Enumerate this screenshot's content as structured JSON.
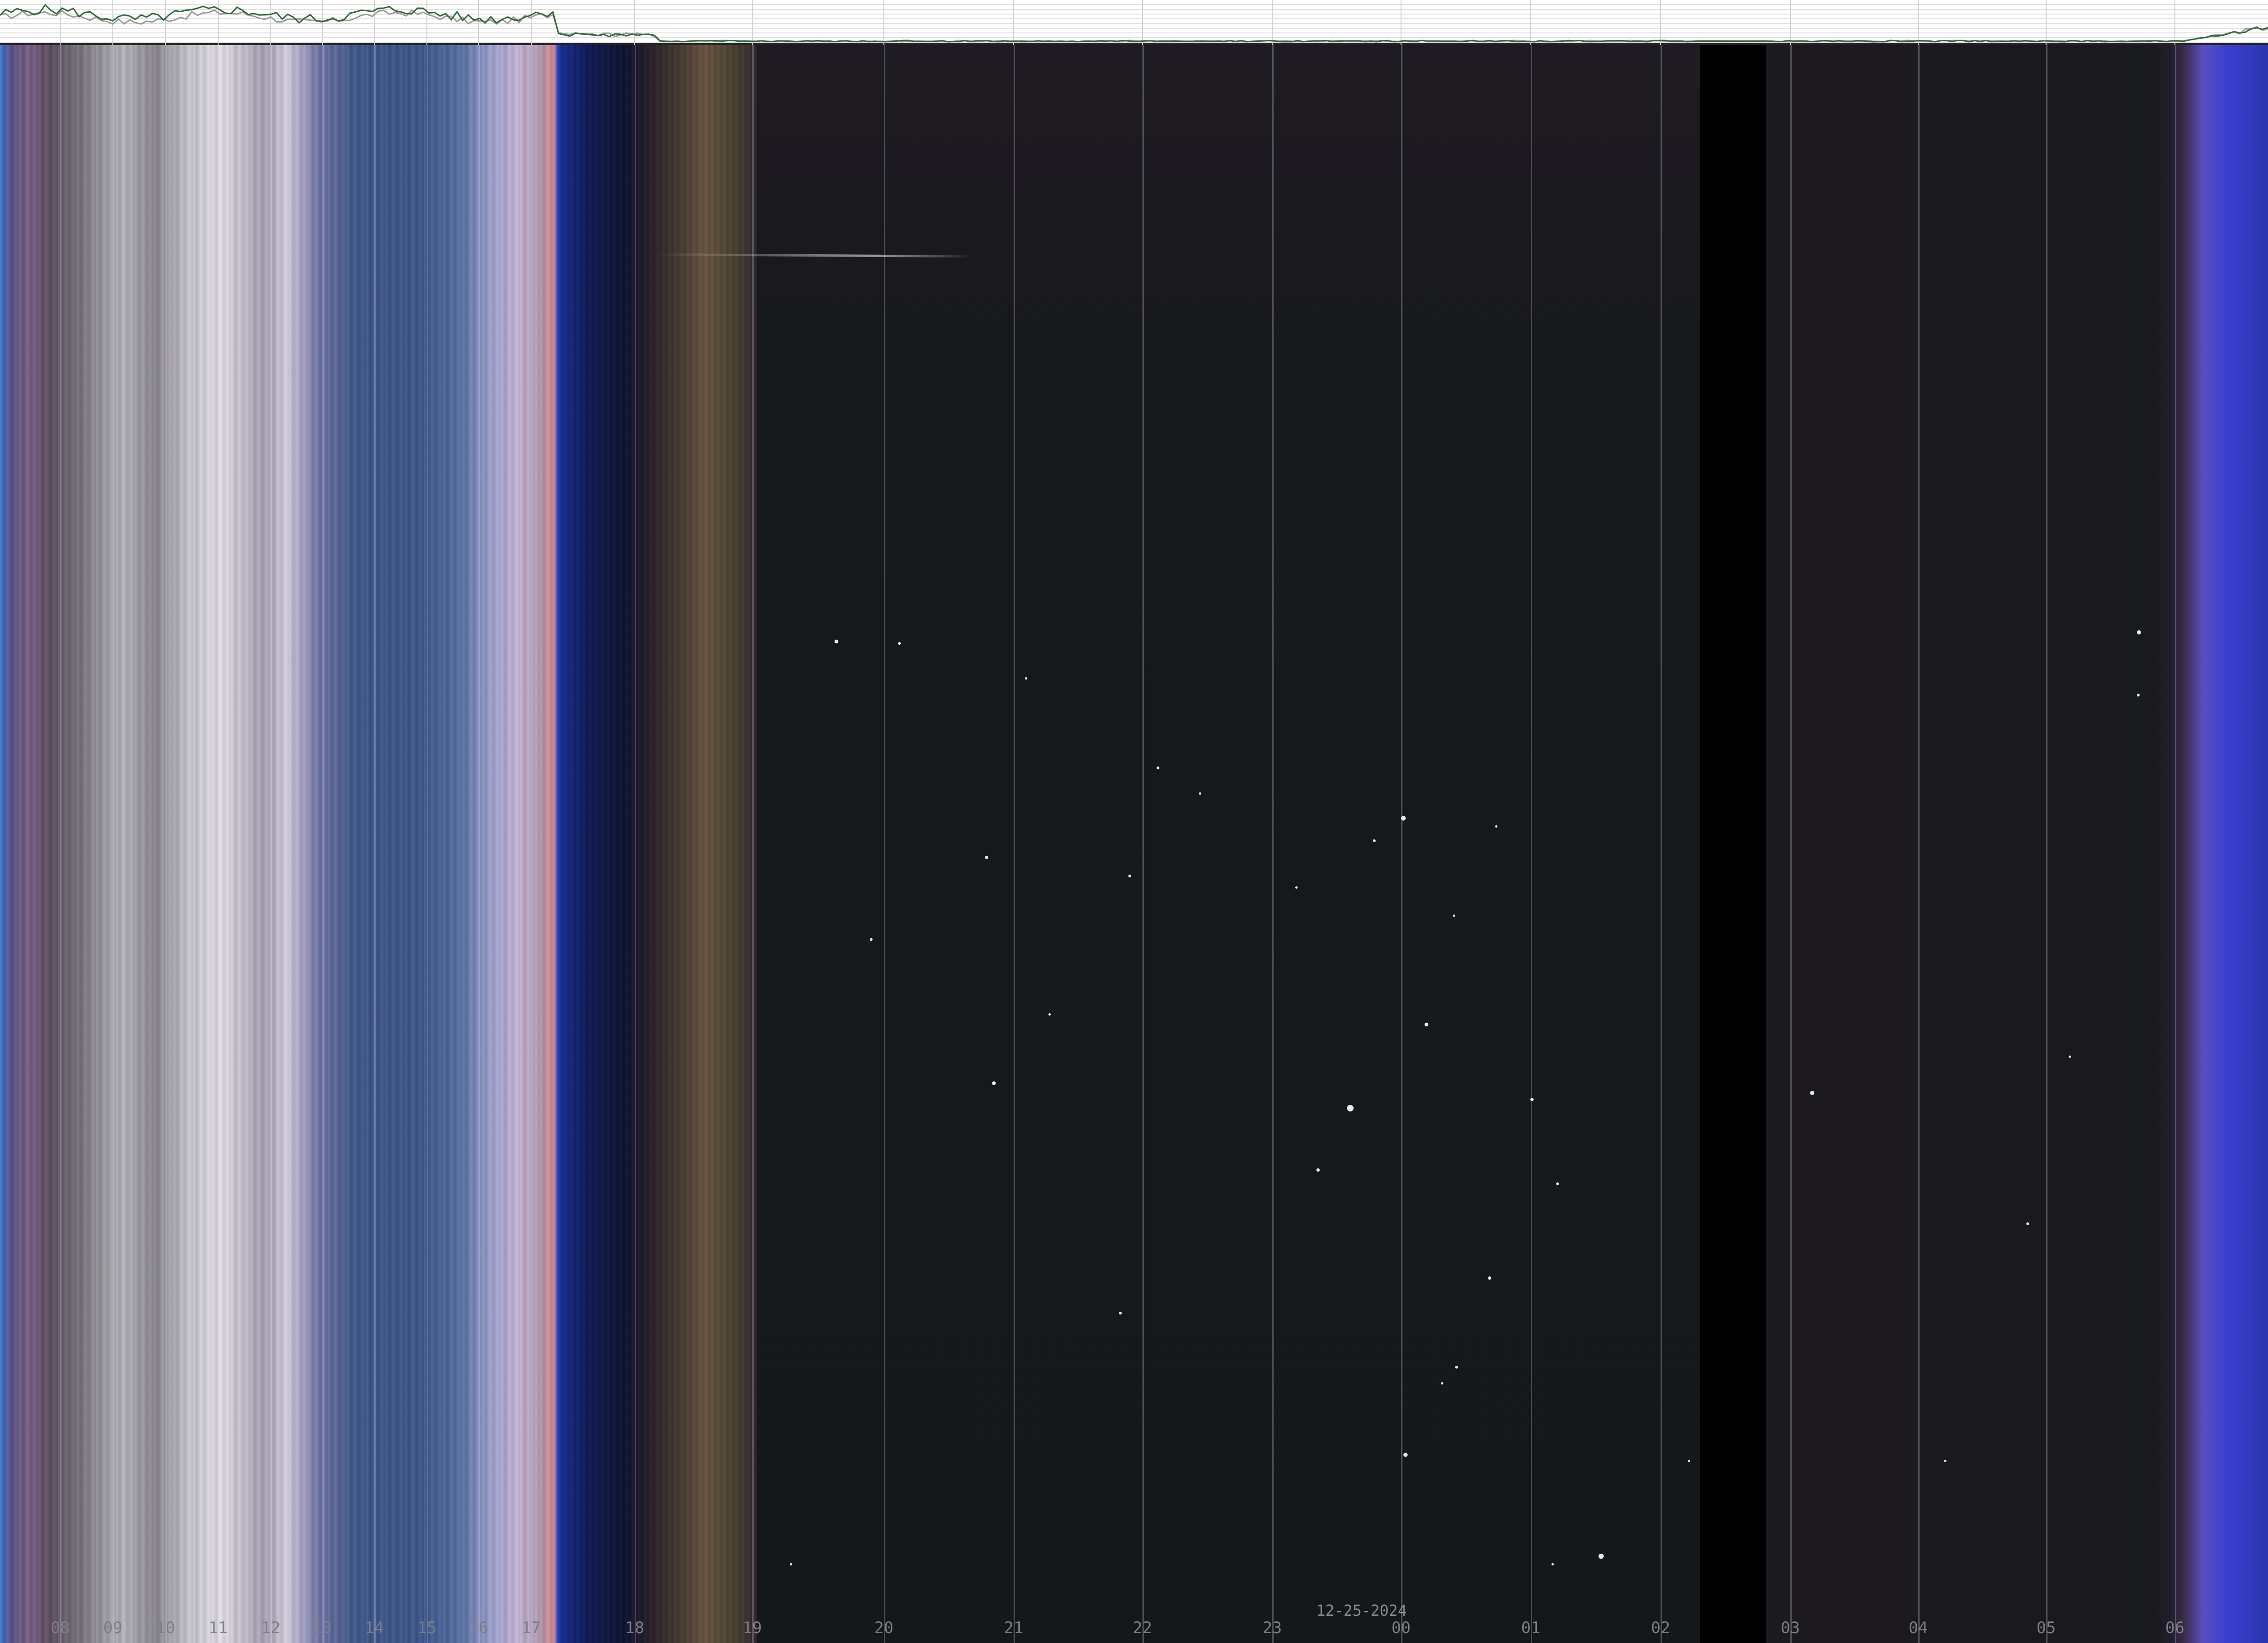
{
  "strip_chart": {
    "series": [
      {
        "color": "#2e6b3a"
      },
      {
        "color": "#9a9a9a"
      }
    ]
  },
  "keogram": {
    "date": "12-25-2024",
    "hour_labels": [
      "08",
      "09",
      "10",
      "11",
      "12",
      "13",
      "14",
      "15",
      "16",
      "17",
      "18",
      "19",
      "20",
      "21",
      "22",
      "23",
      "00",
      "01",
      "02",
      "03",
      "04",
      "05",
      "06"
    ]
  }
}
